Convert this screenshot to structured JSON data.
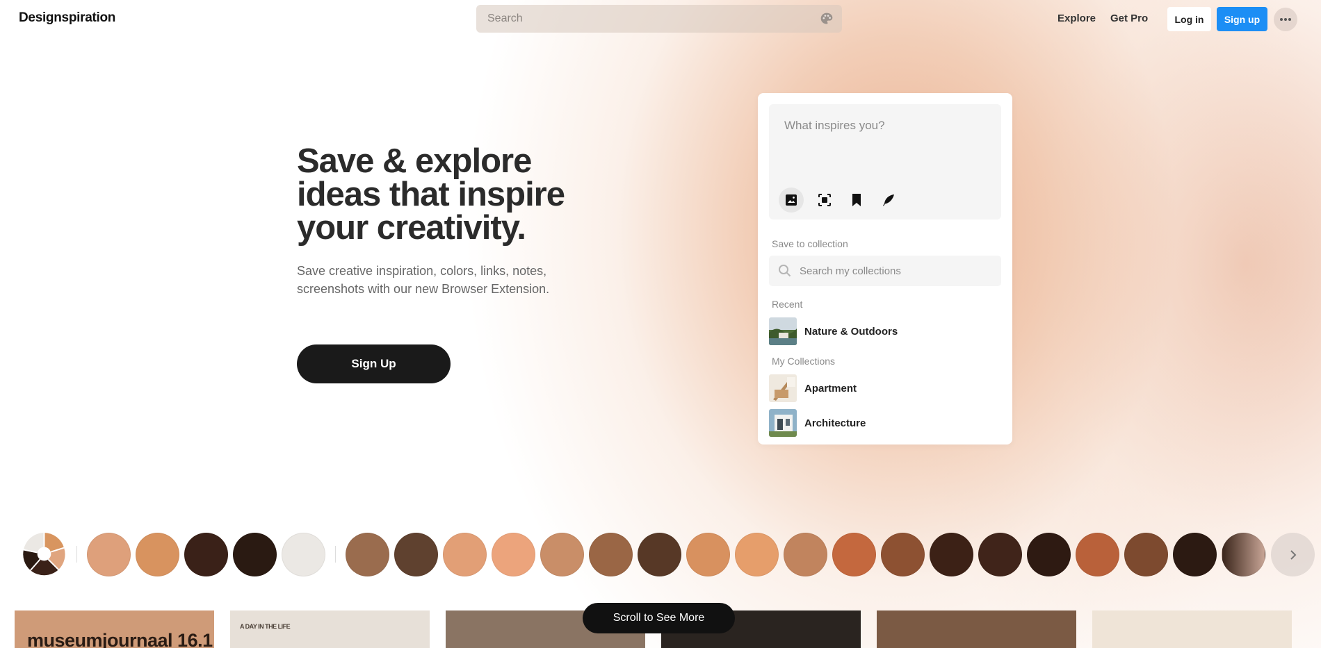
{
  "header": {
    "logo": "Designspiration",
    "search_placeholder": "Search",
    "nav": {
      "explore": "Explore",
      "get_pro": "Get Pro"
    },
    "login": "Log in",
    "signup": "Sign up"
  },
  "hero": {
    "title_line1": "Save & explore",
    "title_line2": "ideas that inspire",
    "title_line3": "your creativity.",
    "sub_line1": "Save creative inspiration, colors, links, notes,",
    "sub_line2": "screenshots with our new Browser Extension.",
    "cta": "Sign Up"
  },
  "extension_card": {
    "compose_placeholder": "What inspires you?",
    "tools": [
      "image-icon",
      "screenshot-icon",
      "bookmark-icon",
      "feather-icon"
    ],
    "save_to_label": "Save to collection",
    "search_placeholder": "Search my collections",
    "recent_label": "Recent",
    "recent": [
      {
        "name": "Nature & Outdoors"
      }
    ],
    "my_collections_label": "My Collections",
    "collections": [
      {
        "name": "Apartment"
      },
      {
        "name": "Architecture"
      }
    ]
  },
  "swatches": {
    "primary": [
      "#dea07b",
      "#d8935f",
      "#3a2118",
      "#2a1a12",
      "#ebe8e4"
    ],
    "colors": [
      "#9a6c4e",
      "#5f412f",
      "#e29f76",
      "#eca47c",
      "#c98e68",
      "#9a6645",
      "#573826",
      "#d8915f",
      "#e69e6b",
      "#c1845e",
      "#c4683e",
      "#8d5132",
      "#3c2116",
      "#40241a",
      "#2e1a12",
      "#b9613a",
      "#7d4a2f",
      "#2c1a12"
    ],
    "gradient_last": [
      "#3a251b",
      "#c8a596"
    ]
  },
  "tiles": [
    {
      "text": "museumjournaal 16.1",
      "bg": "#cf9b78"
    },
    {
      "text": "A DAY IN THE LIFE",
      "bg": "#e7e0d8"
    },
    {
      "text": "",
      "bg": "#8a7463"
    },
    {
      "text": "",
      "bg": "#2a2420"
    },
    {
      "text": "",
      "bg": "#7b5a44"
    },
    {
      "text": "",
      "bg": "#efe4d7"
    }
  ],
  "scroll_label": "Scroll to See More"
}
